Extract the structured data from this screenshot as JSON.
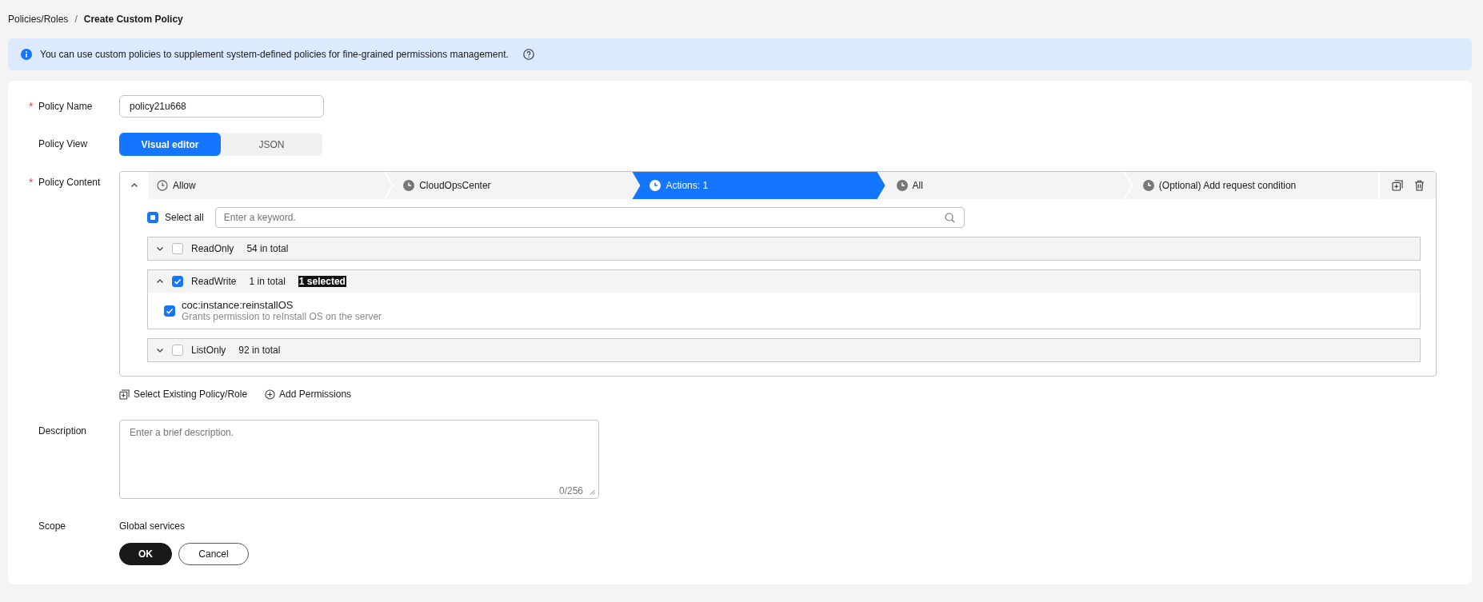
{
  "breadcrumb": {
    "parent": "Policies/Roles",
    "separator": "/",
    "current": "Create Custom Policy"
  },
  "notice": {
    "text": "You can use custom policies to supplement system-defined policies for fine-grained permissions management."
  },
  "policy_name": {
    "label": "Policy Name",
    "required_mark": "*",
    "value": "policy21u668"
  },
  "policy_view": {
    "label": "Policy View",
    "tabs": [
      {
        "label": "Visual editor",
        "selected": true
      },
      {
        "label": "JSON",
        "selected": false
      }
    ]
  },
  "policy_content": {
    "label": "Policy Content",
    "required_mark": "*",
    "expanded": true,
    "steps": [
      {
        "label": "Allow",
        "kind": "outline",
        "selected": false
      },
      {
        "label": "CloudOpsCenter",
        "kind": "filled",
        "selected": false
      },
      {
        "label": "Actions: 1",
        "kind": "filled",
        "selected": true
      },
      {
        "label": "All",
        "kind": "filled",
        "selected": false
      },
      {
        "label": "(Optional) Add request condition",
        "kind": "filled",
        "selected": false
      }
    ],
    "select_all": {
      "label": "Select all",
      "indeterminate": true
    },
    "search": {
      "placeholder": "Enter a keyword."
    },
    "groups": [
      {
        "name": "ReadOnly",
        "count": "54 in total",
        "checked": false,
        "expanded": false
      },
      {
        "name": "ReadWrite",
        "count": "1 in total",
        "badge": "1 selected",
        "checked": true,
        "expanded": true,
        "actions": [
          {
            "name": "coc:instance:reinstallOS",
            "description": "Grants permission to reInstall OS on the server",
            "checked": true
          }
        ]
      },
      {
        "name": "ListOnly",
        "count": "92 in total",
        "checked": false,
        "expanded": false
      }
    ],
    "links": [
      "Select Existing Policy/Role",
      "Add Permissions"
    ]
  },
  "description": {
    "label": "Description",
    "placeholder": "Enter a brief description.",
    "counter": "0/256"
  },
  "scope": {
    "label": "Scope",
    "value": "Global services"
  },
  "buttons": [
    {
      "label": "OK",
      "kind": "primary"
    },
    {
      "label": "Cancel",
      "kind": "secondary"
    }
  ]
}
